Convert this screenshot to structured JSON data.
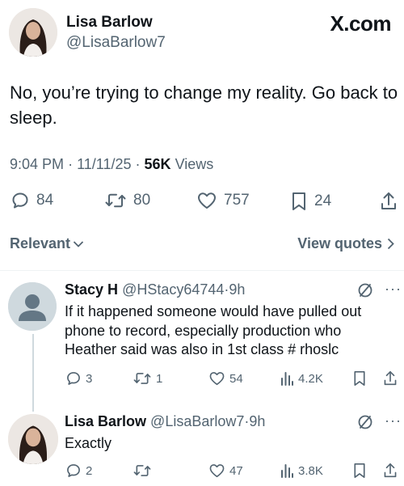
{
  "tweet": {
    "author_name": "Lisa Barlow",
    "author_handle": "@LisaBarlow7",
    "brand": "X.com",
    "text": "No, you’re trying to change my reality. Go back to sleep.",
    "time": "9:04 PM",
    "date": "11/11/25",
    "views_count": "56K",
    "views_label": "Views",
    "separator": "·",
    "actions": {
      "replies": "84",
      "reposts": "80",
      "likes": "757",
      "bookmarks": "24"
    }
  },
  "replies_header": {
    "sort_label": "Relevant",
    "view_quotes_label": "View quotes"
  },
  "replies": [
    {
      "name": "Stacy H",
      "handle": "@HStacy64744",
      "time": "9h",
      "text": "If it happened someone would have pulled out phone to record, especially production  who Heather said was also in 1st class # rhoslc",
      "replies": "3",
      "reposts": "1",
      "likes": "54",
      "views": "4.2K"
    },
    {
      "name": "Lisa Barlow",
      "handle": "@LisaBarlow7",
      "time": "9h",
      "text": "Exactly",
      "replies": "2",
      "reposts": "",
      "likes": "47",
      "views": "3.8K"
    }
  ],
  "icons": {
    "reply": "speech-bubble-icon",
    "repost": "repost-arrows-icon",
    "like": "heart-icon",
    "bookmark": "bookmark-icon",
    "share": "share-upload-icon",
    "views": "bar-chart-icon",
    "grok": "grok-slash-icon",
    "more": "more-dots-icon",
    "chevron_down": "chevron-down-icon",
    "chevron_right": "chevron-right-icon"
  },
  "colors": {
    "text": "#0f1419",
    "secondary": "#536471",
    "divider": "#eff3f4",
    "thread_line": "#cfd9de"
  }
}
